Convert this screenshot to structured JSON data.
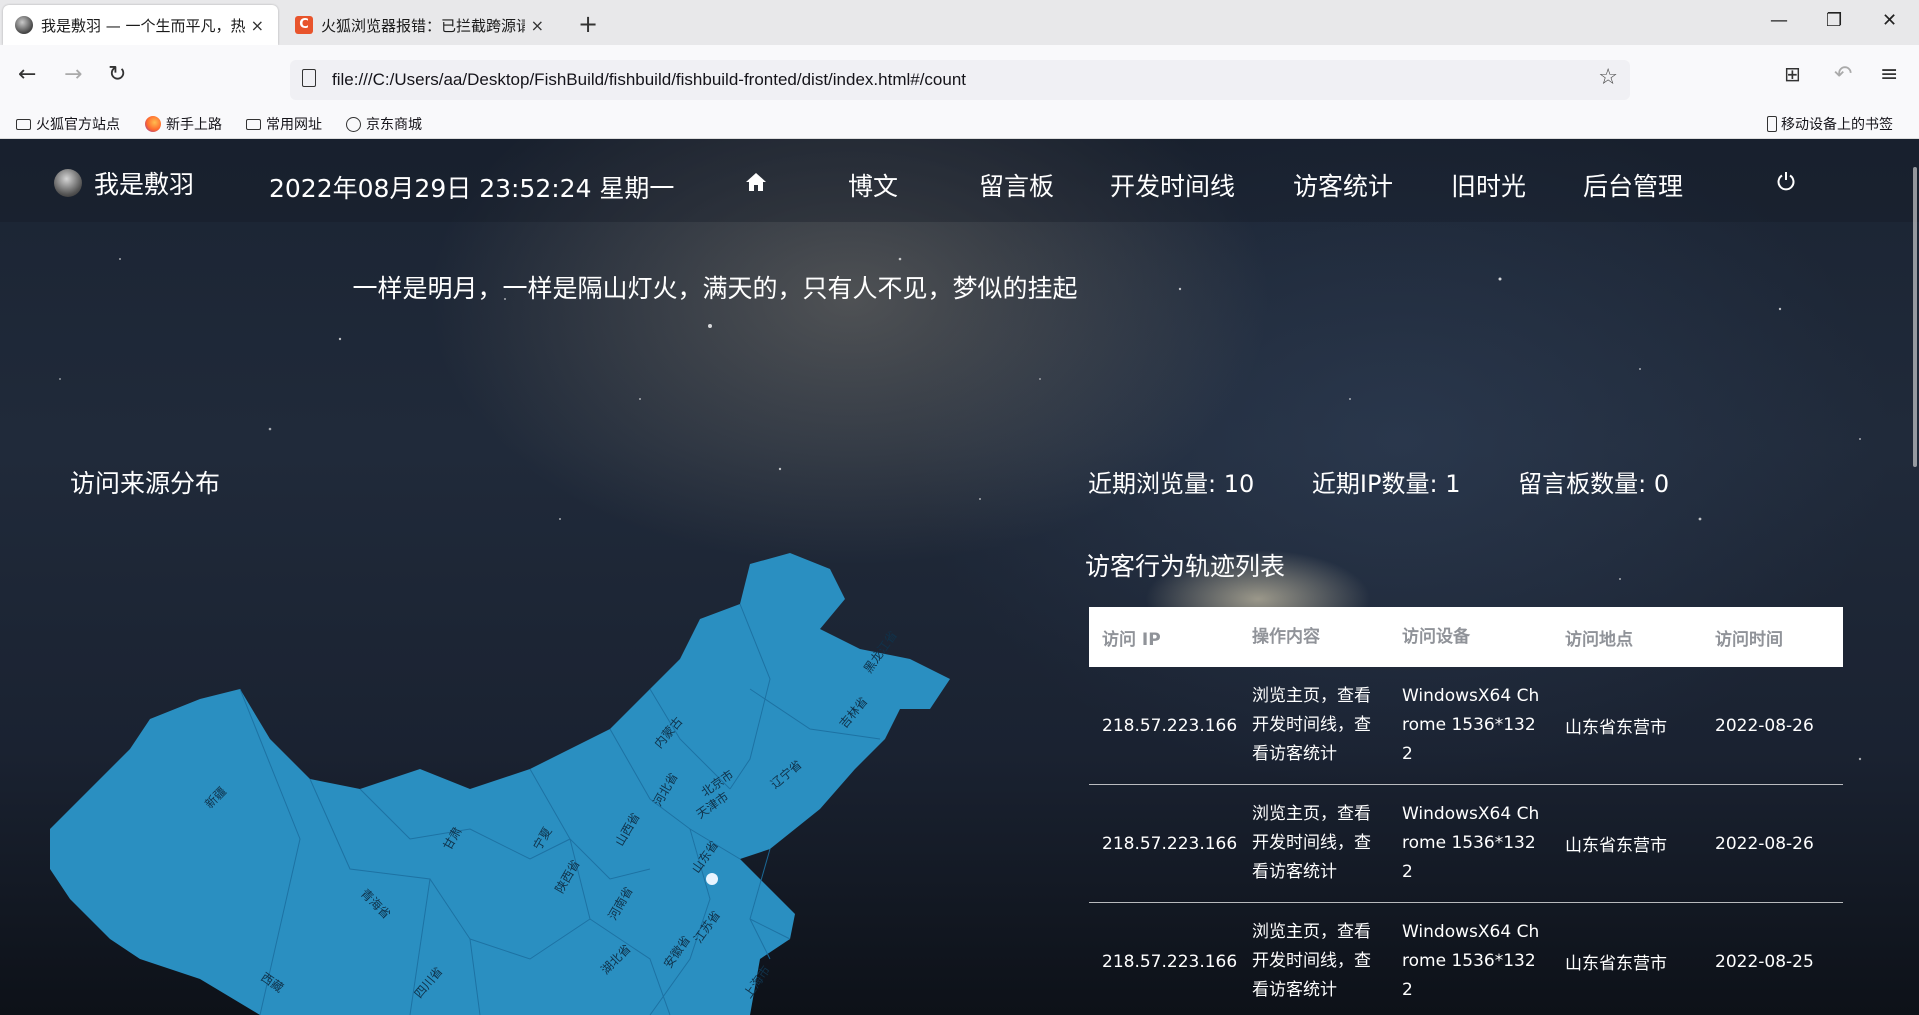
{
  "browser": {
    "tabs": [
      {
        "title": "我是敷羽 — 一个生而平凡，热爱",
        "close": "×"
      },
      {
        "title": "火狐浏览器报错：已拦截跨源请求",
        "close": "×"
      }
    ],
    "new_tab": "+",
    "url": "file:///C:/Users/aa/Desktop/FishBuild/fishbuild/fishbuild-fronted/dist/index.html#/count",
    "bookmarks": [
      "火狐官方站点",
      "新手上路",
      "常用网址",
      "京东商城"
    ],
    "mobile_bookmarks": "移动设备上的书签"
  },
  "site": {
    "brand": "我是敷羽",
    "clock": "2022年08月29日 23:52:24 星期一",
    "nav": [
      "博文",
      "留言板",
      "开发时间线",
      "访客统计",
      "旧时光",
      "后台管理"
    ],
    "motto": "一样是明月，一样是隔山灯火，满天的，只有人不见，梦似的挂起"
  },
  "map": {
    "title": "访问来源分布",
    "fill_color": "#2a8fc1",
    "labels": [
      "黑龙江省",
      "吉林省",
      "辽宁省",
      "内蒙古",
      "北京市",
      "天津市",
      "河北省",
      "山东省",
      "山西省",
      "宁夏",
      "陕西省",
      "河南省",
      "甘肃",
      "青海省",
      "新疆",
      "西藏",
      "四川省",
      "湖北省",
      "安徽省",
      "江苏省",
      "上海市"
    ]
  },
  "stats": {
    "views_label": "近期浏览量:",
    "views_value": "10",
    "ips_label": "近期IP数量:",
    "ips_value": "1",
    "messages_label": "留言板数量:",
    "messages_value": "0"
  },
  "table": {
    "title": "访客行为轨迹列表",
    "headers": [
      "访问 IP",
      "操作内容",
      "访问设备",
      "访问地点",
      "访问时间"
    ],
    "rows": [
      {
        "ip": "218.57.223.166",
        "action": "浏览主页，查看开发时间线，查看访客统计",
        "device": "WindowsX64 Chrome 1536*1322",
        "location": "山东省东营市",
        "time": "2022-08-26"
      },
      {
        "ip": "218.57.223.166",
        "action": "浏览主页，查看开发时间线，查看访客统计",
        "device": "WindowsX64 Chrome 1536*1322",
        "location": "山东省东营市",
        "time": "2022-08-26"
      },
      {
        "ip": "218.57.223.166",
        "action": "浏览主页，查看开发时间线，查看访客统计",
        "device": "WindowsX64 Chrome 1536*1322",
        "location": "山东省东营市",
        "time": "2022-08-25"
      }
    ]
  }
}
